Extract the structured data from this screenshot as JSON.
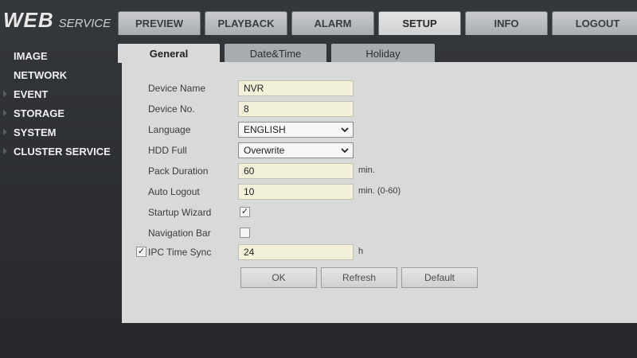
{
  "logo": {
    "word1": "WEB",
    "word2": "SERVICE"
  },
  "topnav": [
    "PREVIEW",
    "PLAYBACK",
    "ALARM",
    "SETUP",
    "INFO",
    "LOGOUT"
  ],
  "topnav_active": "SETUP",
  "sidebar": [
    "IMAGE",
    "NETWORK",
    "EVENT",
    "STORAGE",
    "SYSTEM",
    "CLUSTER SERVICE"
  ],
  "subtabs": [
    "General",
    "Date&Time",
    "Holiday"
  ],
  "subtab_active": "General",
  "form": {
    "device_name": {
      "label": "Device Name",
      "value": "NVR"
    },
    "device_no": {
      "label": "Device No.",
      "value": "8"
    },
    "language": {
      "label": "Language",
      "value": "ENGLISH"
    },
    "hdd_full": {
      "label": "HDD Full",
      "value": "Overwrite"
    },
    "pack_duration": {
      "label": "Pack Duration",
      "value": "60",
      "unit": "min."
    },
    "auto_logout": {
      "label": "Auto Logout",
      "value": "10",
      "unit": "min. (0-60)"
    },
    "startup_wizard": {
      "label": "Startup Wizard",
      "checked": true
    },
    "navigation_bar": {
      "label": "Navigation Bar",
      "checked": false
    },
    "ipc_time_sync": {
      "label": "IPC Time Sync",
      "checked": true,
      "value": "24",
      "unit": "h"
    }
  },
  "buttons": {
    "ok": "OK",
    "refresh": "Refresh",
    "default": "Default"
  },
  "colors": {
    "panel": "#d8d9d9",
    "input_bg": "#f3f1d9",
    "background": "#2e3033"
  }
}
